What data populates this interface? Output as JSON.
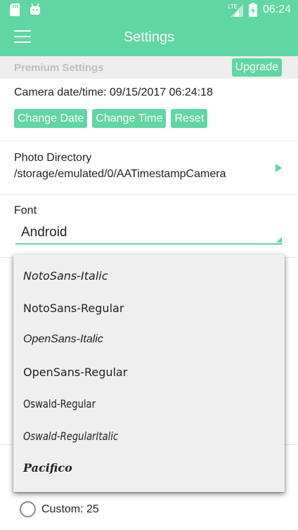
{
  "status_bar": {
    "time": "06:24",
    "network": "LTE",
    "icons": [
      "sd-card-icon",
      "android-icon",
      "signal-icon",
      "battery-charging-icon"
    ]
  },
  "app_bar": {
    "title": "Settings",
    "menu_icon": "hamburger-menu-icon"
  },
  "premium": {
    "label": "Premium Settings",
    "upgrade_label": "Upgrade"
  },
  "camera": {
    "datetime_text": "Camera date/time: 09/15/2017 06:24:18",
    "buttons": [
      "Change Date",
      "Change Time",
      "Reset"
    ]
  },
  "photo_directory": {
    "label": "Photo Directory",
    "path": "/storage/emulated/0/AATimestampCamera"
  },
  "font": {
    "label": "Font",
    "selected": "Android",
    "options": [
      "NotoSans-Italic",
      "NotoSans-Regular",
      "OpenSans-Italic",
      "OpenSans-Regular",
      "Oswald-Regular",
      "Oswald-RegularItalic",
      "Pacifico"
    ]
  },
  "font_size": {
    "custom_label": "Custom: 25"
  },
  "colors": {
    "accent": "#5fd6a3",
    "premium_bar": "#eeeeee",
    "dropdown_bg": "#efefef"
  }
}
